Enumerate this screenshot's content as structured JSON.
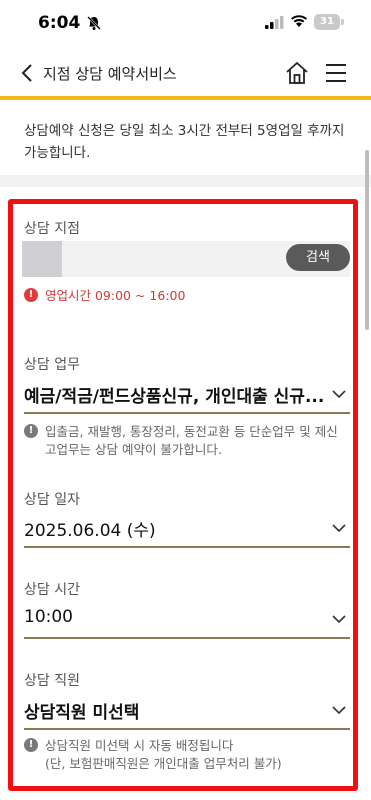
{
  "status_bar": {
    "time": "6:04",
    "battery": "31"
  },
  "header": {
    "title": "지점 상담 예약서비스"
  },
  "notice": "상담예약 신청은 당일 최소 3시간 전부터 5영업일 후까지 가능합니다.",
  "form": {
    "branch": {
      "label": "상담 지점",
      "search_label": "검색",
      "hours_warning": "영업시간 09:00 ~ 16:00"
    },
    "task": {
      "label": "상담 업무",
      "value": "예금/적금/펀드상품신규, 개인대출 신규...",
      "note": "입출금, 재발행, 통장정리, 동전교환 등 단순업무 및 제신고업무는 상담 예약이 불가합니다."
    },
    "date": {
      "label": "상담 일자",
      "value": "2025.06.04 (수)"
    },
    "time": {
      "label": "상담 시간",
      "value": "10:00"
    },
    "staff": {
      "label": "상담 직원",
      "value": "상담직원 미선택",
      "note_line1": "상담직원 미선택 시 자동 배정됩니다",
      "note_line2": "(단, 보험판매직원은 개인대출 업무처리 불가)"
    }
  },
  "colors": {
    "accent": "#f4b81c",
    "highlight_frame": "#ee1111",
    "underline": "#8a7a55",
    "warning": "#d23a3a"
  }
}
